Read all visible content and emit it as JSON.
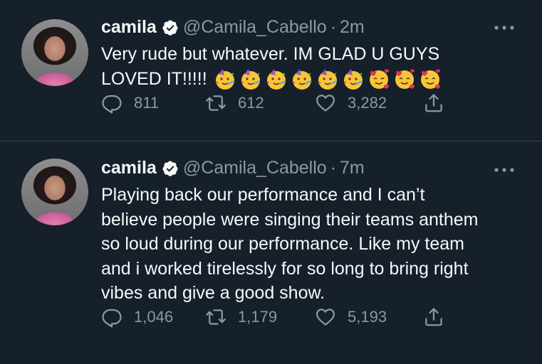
{
  "tweets": [
    {
      "name": "camila",
      "handle": "@Camila_Cabello",
      "separator": "·",
      "time": "2m",
      "text_line1": "Very rude but whatever. IM GLAD U GUYS",
      "text_line2": "LOVED IT!!!!! ",
      "replies": "811",
      "retweets": "612",
      "likes": "3,282",
      "emojis": [
        "party-face-emoji",
        "party-face-emoji",
        "party-face-emoji",
        "party-face-emoji",
        "party-face-emoji",
        "party-face-emoji",
        "smiling-face-with-hearts-emoji",
        "smiling-face-with-hearts-emoji",
        "smiling-face-with-hearts-emoji"
      ]
    },
    {
      "name": "camila",
      "handle": "@Camila_Cabello",
      "separator": "·",
      "time": "7m",
      "text_lines": [
        "Playing back our performance and I can’t",
        "believe people were singing their teams anthem",
        "so loud during our performance. Like my team",
        "and i worked tirelessly for so long to bring right",
        "vibes and give a good show."
      ],
      "replies": "1,046",
      "retweets": "1,179",
      "likes": "5,193"
    }
  ],
  "colors": {
    "background": "#15202b",
    "text": "#f7f9f9",
    "secondary": "#8b98a5",
    "divider": "#38444d",
    "verified": "#f7f9f9"
  },
  "icons": [
    "verified-badge-icon",
    "more-icon",
    "reply-icon",
    "retweet-icon",
    "like-icon",
    "share-icon"
  ]
}
